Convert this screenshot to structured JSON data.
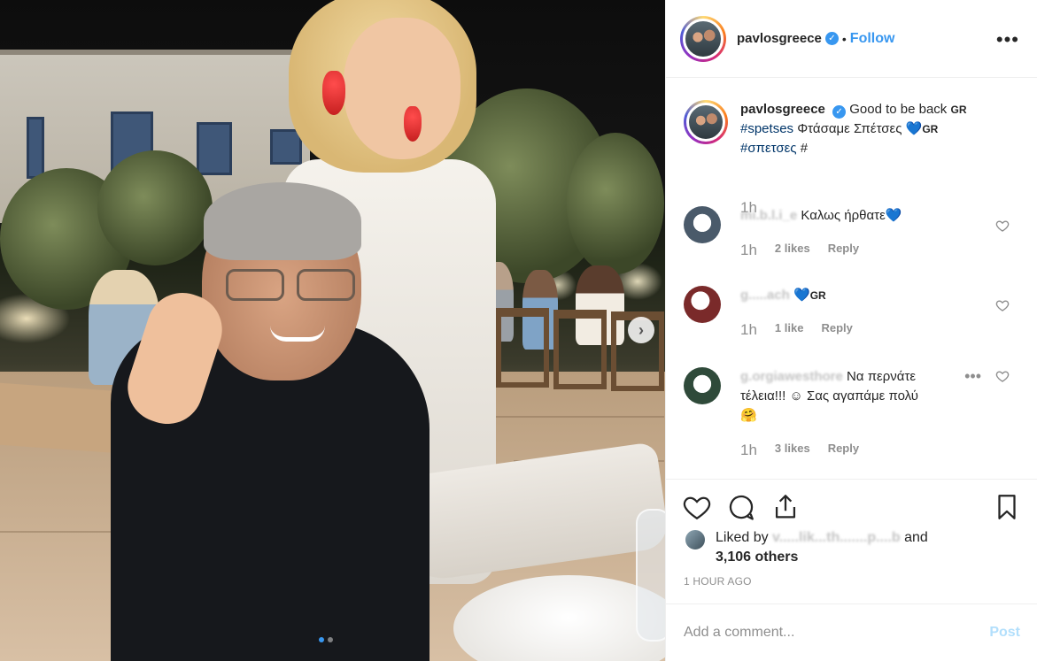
{
  "post": {
    "username": "pavlosgreece",
    "follow_label": "Follow",
    "separator": "•",
    "more_label": "•••",
    "carousel_next": "›"
  },
  "caption": {
    "username": "pavlosgreece",
    "text": "Good to be back",
    "flag1": "GR",
    "hashtag1": "#spetses",
    "text2": "Φτάσαμε Σπέτσες",
    "heart": "💙",
    "flag2": "GR",
    "hashtag2": "#σπετσες",
    "trailing": "#",
    "time": "1h"
  },
  "comments": [
    {
      "username_masked": "mi.b.l.i_e",
      "text": "Καλως ήρθατε",
      "heart": "💙",
      "time": "1h",
      "likes": "2 likes",
      "reply": "Reply"
    },
    {
      "username_masked": "g.....ach",
      "text": "💙",
      "flag": "GR",
      "time": "1h",
      "likes": "1 like",
      "reply": "Reply"
    },
    {
      "username_masked": "g.orgiawesthore",
      "text_line1": "Να περνάτε",
      "text_line2": "τέλεια!!! ☺ Σας αγαπάμε πολύ",
      "emoji": "🤗",
      "more": "•••",
      "time": "1h",
      "likes": "3 likes",
      "reply": "Reply"
    }
  ],
  "likes": {
    "prefix": "Liked by",
    "masked_user": "v.....lik...th.......p....b",
    "and": "and",
    "others": "3,106 others"
  },
  "timestamp": "1 HOUR AGO",
  "add_comment": {
    "placeholder": "Add a comment...",
    "post_label": "Post"
  },
  "colors": {
    "accent": "#3897f0",
    "hashtag": "#003569",
    "muted": "#8e8e8e",
    "post_disabled": "#b2dffc"
  }
}
